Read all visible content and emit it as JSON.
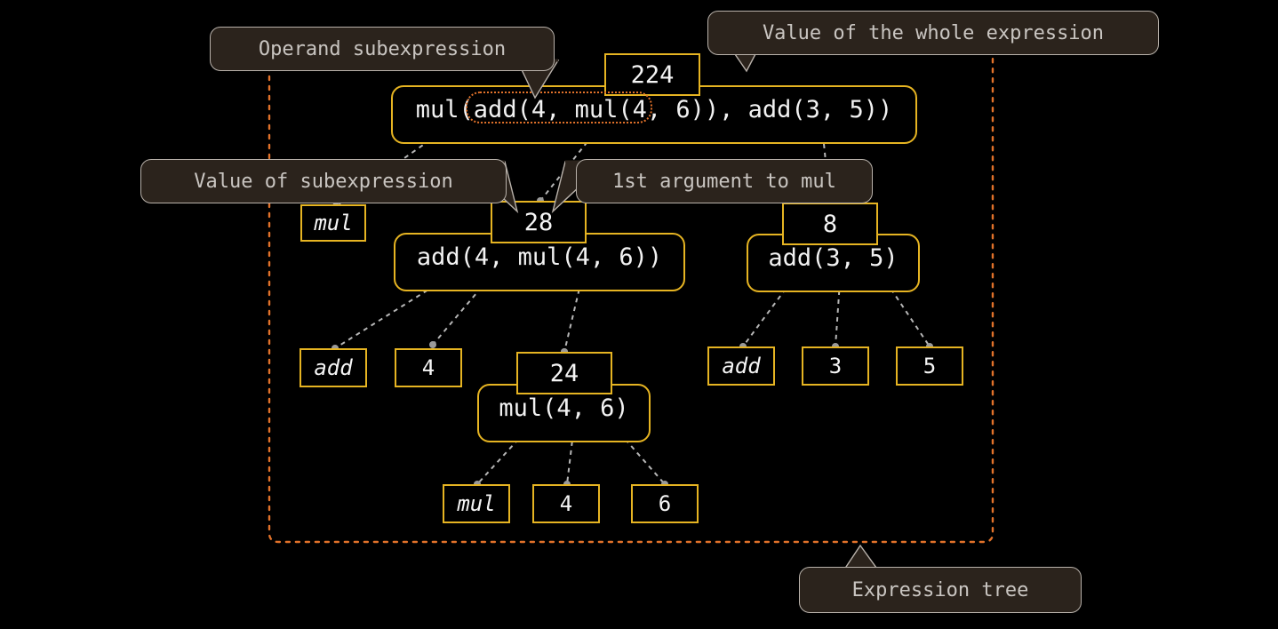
{
  "diagram": {
    "title": "Expression tree diagram",
    "colors": {
      "background": "#000000",
      "box_border": "#e6b422",
      "box_text": "#f5f5f5",
      "callout_bg": "#2b231c",
      "callout_border": "#b9b2ab",
      "callout_text": "#c9c5c1",
      "highlight_dotted": "#e2722a",
      "connector": "#9a9a9a"
    }
  },
  "callouts": {
    "operand_subexpression": "Operand subexpression",
    "value_of_whole_expression": "Value of the whole expression",
    "value_of_subexpression": "Value of subexpression",
    "first_argument_to_mul": "1st argument to mul",
    "expression_tree": "Expression tree"
  },
  "tree": {
    "root": {
      "expression": "mul(add(4, mul(4, 6)), add(3, 5))",
      "value": "224",
      "highlighted_operand": "add(4, mul(4, 6))"
    },
    "level2": {
      "operator_leaf": "mul",
      "left_value": "28",
      "left_expression": "add(4, mul(4, 6))",
      "right_value": "8",
      "right_expression": "add(3, 5)"
    },
    "level3_left": {
      "operator_leaf": "add",
      "first_arg": "4",
      "second_value": "24",
      "second_expression": "mul(4, 6)"
    },
    "level3_right": {
      "operator_leaf": "add",
      "first_arg": "3",
      "second_arg": "5"
    },
    "level4": {
      "operator_leaf": "mul",
      "first_arg": "4",
      "second_arg": "6"
    }
  }
}
